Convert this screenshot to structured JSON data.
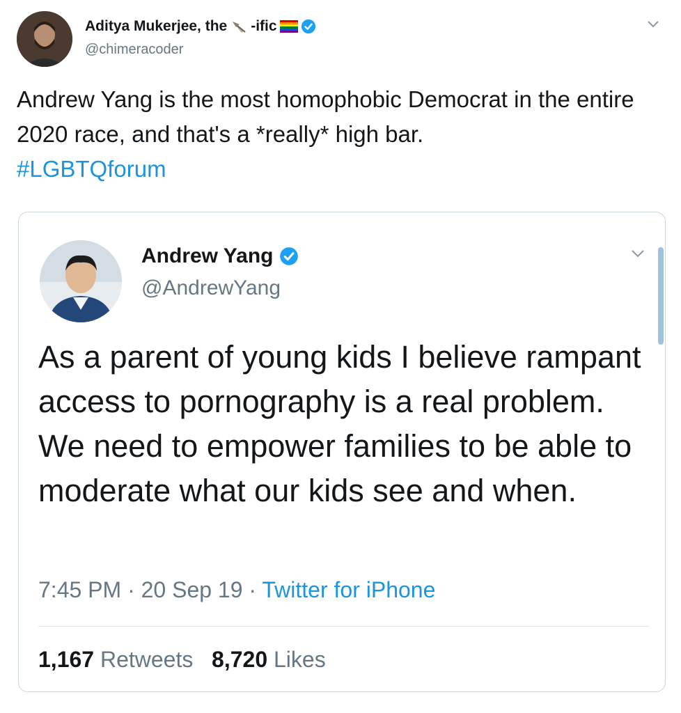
{
  "outer_tweet": {
    "display_name": "Aditya Mukerjee, the",
    "name_suffix": "-ific",
    "handle": "@chimeracoder",
    "text": "Andrew Yang is the most homophobic Democrat in the entire 2020 race, and that's a *really* high bar.",
    "hashtag": "#LGBTQforum",
    "verified_icon": "verified-badge-icon",
    "emoji_icons": [
      "feather-icon",
      "rainbow-flag-icon"
    ],
    "menu_icon": "chevron-down-icon"
  },
  "quoted_tweet": {
    "display_name": "Andrew Yang",
    "handle": "@AndrewYang",
    "text": "As a parent of young kids I believe rampant access to pornography is a real problem. We need to empower families to be able to moderate what our kids see and when.",
    "time": "7:45 PM",
    "date": "20 Sep 19",
    "separator": "·",
    "source": "Twitter for iPhone",
    "retweets_count": "1,167",
    "retweets_label": "Retweets",
    "likes_count": "8,720",
    "likes_label": "Likes",
    "verified_icon": "verified-badge-icon",
    "menu_icon": "chevron-down-icon"
  },
  "colors": {
    "link": "#1b95e0",
    "secondary_text": "#657786",
    "primary_text": "#14171a",
    "border": "#ccd6dd",
    "verified": "#1da1f2"
  }
}
